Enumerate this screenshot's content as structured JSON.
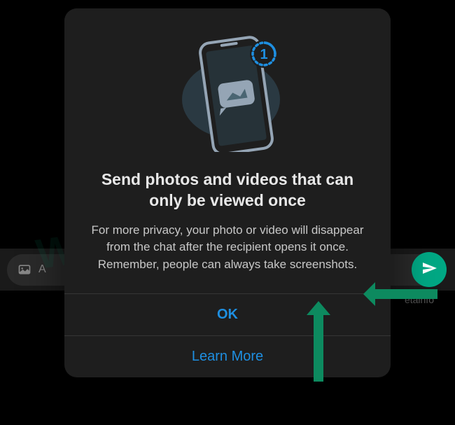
{
  "background": {
    "input_placeholder": "A",
    "watermark": "WABETAINFO",
    "watermark_small": "etainfo"
  },
  "modal": {
    "title": "Send photos and videos that can only be viewed once",
    "body": "For more privacy, your photo or video will disappear from the chat after the recipient opens it once. Remember, people can always take screenshots.",
    "ok_label": "OK",
    "learn_more_label": "Learn More",
    "badge_number": "1"
  },
  "colors": {
    "accent": "#1e8fe1",
    "send": "#00a884",
    "annotation": "#0d8a5f"
  }
}
